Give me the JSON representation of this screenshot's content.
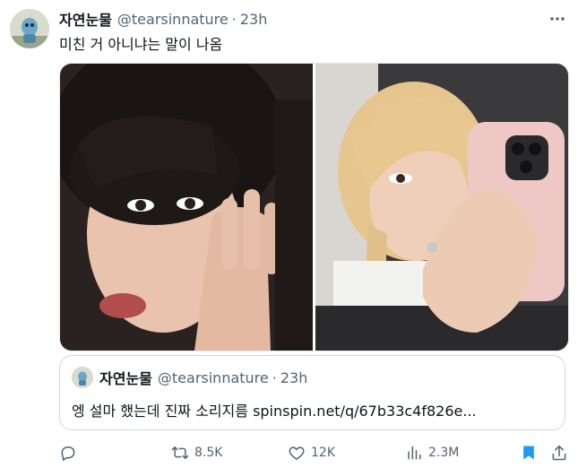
{
  "tweet": {
    "display_name": "자연눈물",
    "handle": "@tearsinnature",
    "separator": "·",
    "time": "23h",
    "text": "미친 거 아니냐는 말이 나옴"
  },
  "quote": {
    "display_name": "자연눈물",
    "handle": "@tearsinnature",
    "separator": "·",
    "time": "23h",
    "text": "엥 설마 했는데 진짜 소리지름  spinspin.net/q/67b33c4f826e..."
  },
  "actions": {
    "replies": "",
    "retweets": "8.5K",
    "likes": "12K",
    "views": "2.3M"
  },
  "colors": {
    "text_primary": "#0f1419",
    "text_secondary": "#536471",
    "bookmark_blue": "#1d9bf0",
    "border": "#cfd9de"
  },
  "icons": {
    "more": "ellipsis-icon",
    "reply": "speech-bubble-icon",
    "retweet": "retweet-arrows-icon",
    "like": "heart-icon",
    "views": "bar-chart-icon",
    "bookmark": "bookmark-filled-icon",
    "share": "share-upload-icon"
  }
}
